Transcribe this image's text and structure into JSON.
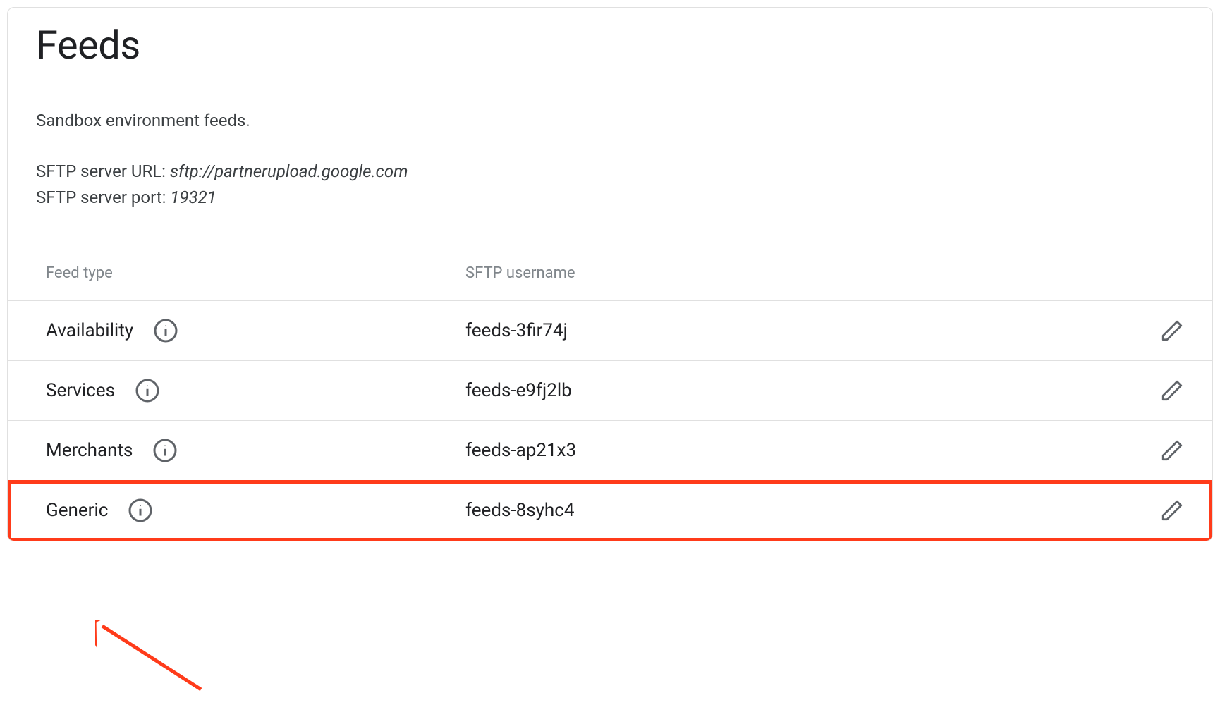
{
  "title": "Feeds",
  "subtitle": "Sandbox environment feeds.",
  "server": {
    "url_label": "SFTP server URL:",
    "url_value": "sftp://partnerupload.google.com",
    "port_label": "SFTP server port:",
    "port_value": "19321"
  },
  "table": {
    "headers": {
      "feed_type": "Feed type",
      "sftp_username": "SFTP username"
    },
    "rows": [
      {
        "type": "Availability",
        "username": "feeds-3fir74j",
        "highlight": false
      },
      {
        "type": "Services",
        "username": "feeds-e9fj2lb",
        "highlight": false
      },
      {
        "type": "Merchants",
        "username": "feeds-ap21x3",
        "highlight": false
      },
      {
        "type": "Generic",
        "username": "feeds-8syhc4",
        "highlight": true
      }
    ]
  }
}
